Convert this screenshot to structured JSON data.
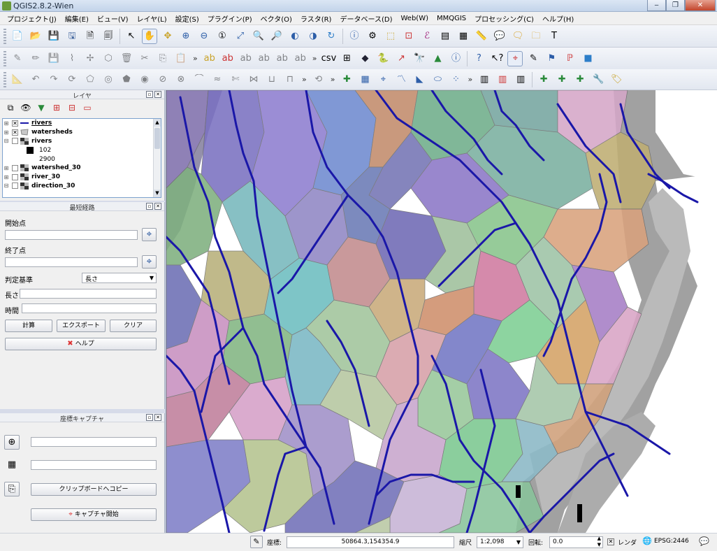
{
  "window": {
    "title": "QGIS2.8.2-Wien",
    "buttons": [
      "‒",
      "❐",
      "✕"
    ]
  },
  "menubar": {
    "items": [
      "プロジェクト(J)",
      "編集(E)",
      "ビュー(V)",
      "レイヤ(L)",
      "設定(S)",
      "プラグイン(P)",
      "ベクタ(O)",
      "ラスタ(R)",
      "データベース(D)",
      "Web(W)",
      "MMQGIS",
      "プロセッシング(C)",
      "ヘルプ(H)"
    ]
  },
  "toolbars": {
    "row1": [
      "new-project-icon",
      "open-project-icon",
      "save-project-icon",
      "save-as-icon",
      "new-print-composer-icon",
      "composer-manager-icon",
      "|",
      "pan-to-selection-icon",
      "pan-icon",
      "pan-selected-icon",
      "zoom-in-icon",
      "zoom-out-icon",
      "zoom-native-icon",
      "zoom-full-icon",
      "zoom-layer-icon",
      "zoom-selection-icon",
      "zoom-last-icon",
      "zoom-next-icon",
      "refresh-icon",
      "|",
      "identify-icon",
      "select-features-icon",
      "deselect-icon",
      "field-calculator-icon",
      "attribute-table-icon",
      "statistics-icon",
      "measure-icon",
      "annotation-icon",
      "map-tips-icon",
      "text-annotation-icon",
      "label-icon"
    ],
    "row2": [
      "edit-pencil-icon",
      "toggle-edit-icon",
      "save-edits-icon",
      "add-feature-icon",
      "move-feature-icon",
      "node-tool-icon",
      "delete-selected-icon",
      "cut-icon",
      "copy-icon",
      "paste-icon",
      "label-pin-icon",
      "label-show-icon",
      "label-move-icon",
      "label-rotate-icon",
      "label-change-icon",
      "csv-icon",
      "sql-icon",
      "raster-calc-icon",
      "python-icon",
      "edit-line-icon",
      "plugin-icon",
      "gps-icon",
      "identify-plus-icon",
      "help-book-icon",
      "whats-this-icon",
      "coordinate-capture-icon",
      "digitize-icon",
      "road-graph-icon",
      "script-icon",
      "blue-square-icon"
    ],
    "row3": [
      "ruler-icon",
      "undo-icon",
      "redo-icon",
      "rotate-feature-icon",
      "simplify-icon",
      "add-ring-icon",
      "add-part-icon",
      "fill-ring-icon",
      "delete-ring-icon",
      "delete-part-icon",
      "reshape-icon",
      "offset-curve-icon",
      "split-features-icon",
      "split-parts-icon",
      "merge-features-icon",
      "merge-attributes-icon",
      "rotate-point-icon",
      "layer-plus-icon",
      "layer-grid-icon",
      "layer-pin-icon",
      "layer-line-icon",
      "layer-wedge-icon",
      "layer-circle-icon",
      "layer-dots-icon",
      "layer-edit-icon",
      "layer-delete-icon",
      "layer-bar-icon",
      "layer-add2-icon",
      "layer-add3-icon",
      "layer-add4-icon",
      "layer-wrench-icon",
      "layer-tag-icon"
    ]
  },
  "layers_panel": {
    "title": "レイヤ",
    "layers": [
      {
        "name": "rivers",
        "checked": true,
        "expanded": false,
        "selected": true,
        "symbol": "line"
      },
      {
        "name": "watersheds",
        "checked": true,
        "expanded": false,
        "symbol": "polygon"
      },
      {
        "name": "rivers",
        "checked": false,
        "expanded": true,
        "symbol": "raster"
      },
      {
        "legend": "102",
        "color": "#000000"
      },
      {
        "legend": "2900",
        "color": "#ffffff"
      },
      {
        "name": "watershed_30",
        "checked": false,
        "expanded": false,
        "symbol": "raster"
      },
      {
        "name": "river_30",
        "checked": false,
        "expanded": false,
        "symbol": "raster"
      },
      {
        "name": "direction_30",
        "checked": false,
        "expanded": true,
        "symbol": "raster"
      }
    ]
  },
  "route_panel": {
    "title": "最短経路",
    "start_label": "開始点",
    "start_value": "",
    "end_label": "終了点",
    "end_value": "",
    "criterion_label": "判定基準",
    "criterion_value": "長さ",
    "length_label": "長さ",
    "length_value": "",
    "time_label": "時間",
    "time_value": "",
    "calc_button": "計算",
    "export_button": "エクスポート",
    "clear_button": "クリア",
    "help_button": "ヘルプ"
  },
  "capture_panel": {
    "title": "座標キャプチャ",
    "coord1_value": "",
    "coord2_value": "",
    "copy_button": "クリップボードへコピー",
    "start_button": "キャプチャ開始"
  },
  "statusbar": {
    "coord_label": "座標:",
    "coord_value": "50864.3,154354.9",
    "scale_label": "縮尺",
    "scale_value": "1:2,098",
    "rotation_label": "回転:",
    "rotation_value": "0.0",
    "render_label": "レンダ",
    "render_checked": true,
    "crs_label": "EPSG:2446"
  },
  "colors": {
    "river": "#1a17a8",
    "accent": "#3a6ea5"
  }
}
